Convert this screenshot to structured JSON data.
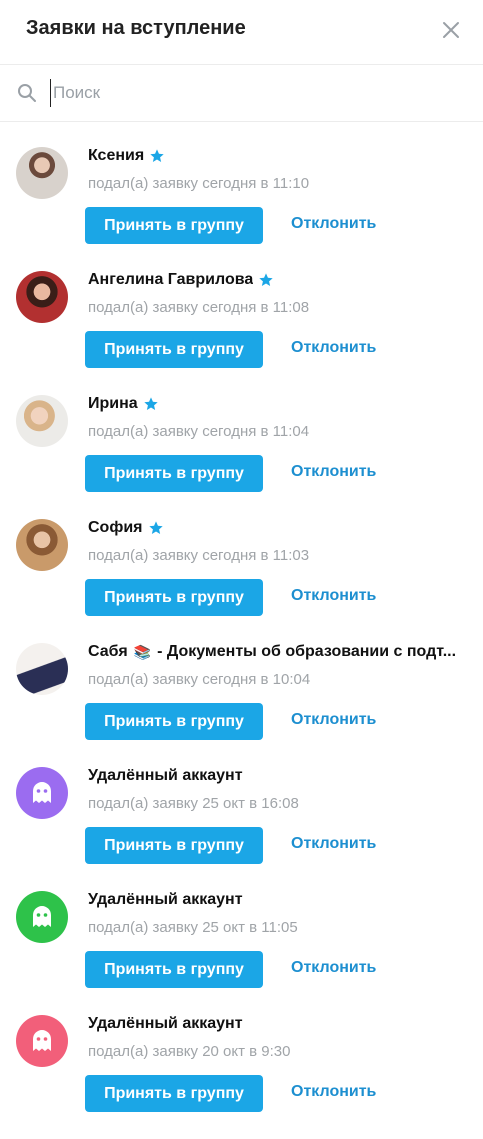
{
  "header": {
    "title": "Заявки на вступление"
  },
  "search": {
    "placeholder": "Поиск",
    "value": ""
  },
  "requests": [
    {
      "name": "Ксения",
      "verified": true,
      "meta": "подал(а) заявку сегодня в 11:10",
      "accept_label": "Принять в группу",
      "decline_label": "Отклонить",
      "avatar": "photo"
    },
    {
      "name": "Ангелина Гаврилова",
      "verified": true,
      "meta": "подал(а) заявку сегодня в 11:08",
      "accept_label": "Принять в группу",
      "decline_label": "Отклонить",
      "avatar": "photo"
    },
    {
      "name": "Ирина",
      "verified": true,
      "meta": "подал(а) заявку сегодня в 11:04",
      "accept_label": "Принять в группу",
      "decline_label": "Отклонить",
      "avatar": "photo"
    },
    {
      "name": "София",
      "verified": true,
      "meta": "подал(а) заявку сегодня в 11:03",
      "accept_label": "Принять в группу",
      "decline_label": "Отклонить",
      "avatar": "photo"
    },
    {
      "name": "Сабя",
      "name_suffix": "- Документы об образовании с подт...",
      "verified": false,
      "meta": "подал(а) заявку сегодня в 10:04",
      "accept_label": "Принять в группу",
      "decline_label": "Отклонить",
      "avatar": "photo"
    },
    {
      "name": "Удалённый аккаунт",
      "verified": false,
      "meta": "подал(а) заявку 25 окт в 16:08",
      "accept_label": "Принять в группу",
      "decline_label": "Отклонить",
      "avatar": "ghost-icon",
      "avatar_color": "#9b6cf0"
    },
    {
      "name": "Удалённый аккаунт",
      "verified": false,
      "meta": "подал(а) заявку 25 окт в 11:05",
      "accept_label": "Принять в группу",
      "decline_label": "Отклонить",
      "avatar": "ghost-icon",
      "avatar_color": "#2ec24a"
    },
    {
      "name": "Удалённый аккаунт",
      "verified": false,
      "meta": "подал(а) заявку 20 окт в 9:30",
      "accept_label": "Принять в группу",
      "decline_label": "Отклонить",
      "avatar": "ghost-icon",
      "avatar_color": "#f25f7a"
    }
  ],
  "colors": {
    "accent": "#1ba6e6",
    "link": "#1d8fd0",
    "verified_star": "#1ba6e6"
  }
}
